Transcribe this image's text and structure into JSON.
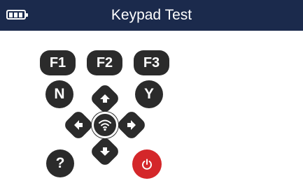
{
  "header": {
    "title": "Keypad Test",
    "battery_icon": "battery-icon",
    "background_color": "#1b2a4c"
  },
  "keypad": {
    "function_keys": [
      {
        "label": "F1"
      },
      {
        "label": "F2"
      },
      {
        "label": "F3"
      }
    ],
    "no_key": "N",
    "yes_key": "Y",
    "help_key": "?",
    "direction_keys": [
      "arrow-up-icon",
      "arrow-left-icon",
      "arrow-right-icon",
      "arrow-down-icon"
    ],
    "center_key_icon": "wireless-icon",
    "power_key_icon": "power-icon",
    "key_color": "#2b2b2b",
    "power_color": "#d4272a"
  }
}
